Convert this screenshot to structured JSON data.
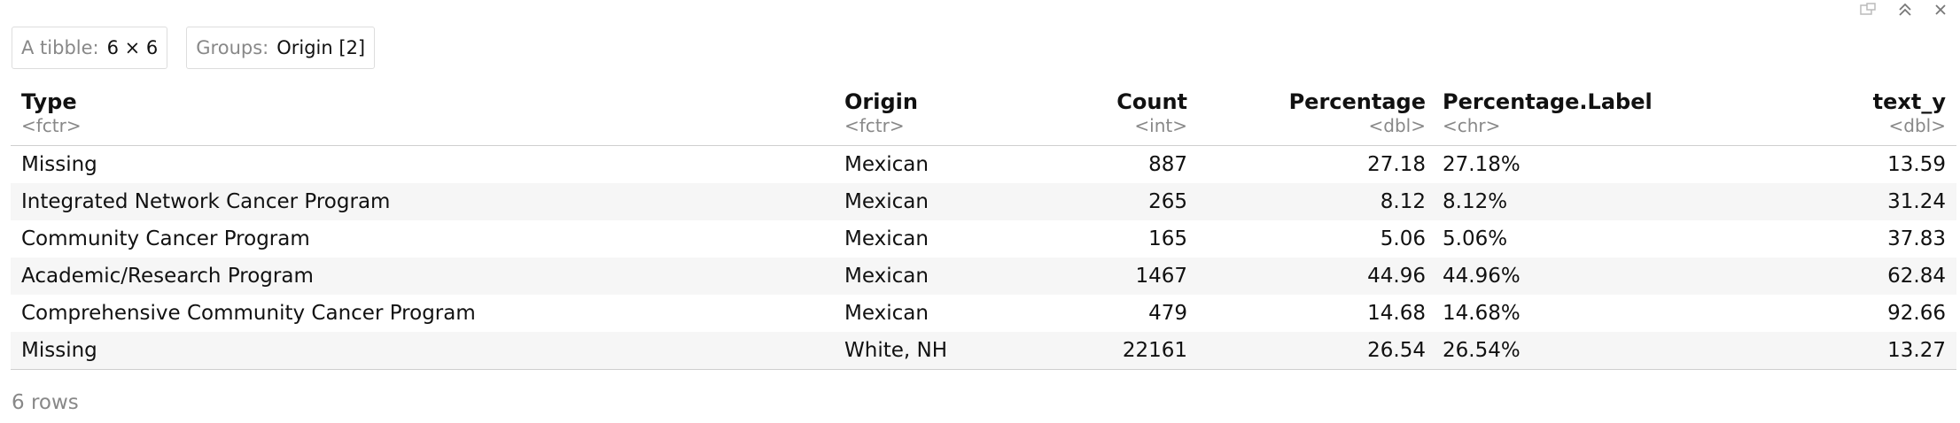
{
  "badges": {
    "tibble": {
      "key": "A tibble:",
      "value": "6 × 6"
    },
    "groups": {
      "key": "Groups:",
      "value": "Origin [2]"
    }
  },
  "columns": [
    {
      "name": "Type",
      "type": "<fctr>"
    },
    {
      "name": "Origin",
      "type": "<fctr>"
    },
    {
      "name": "Count",
      "type": "<int>"
    },
    {
      "name": "Percentage",
      "type": "<dbl>"
    },
    {
      "name": "Percentage.Label",
      "type": "<chr>"
    },
    {
      "name": "text_y",
      "type": "<dbl>"
    }
  ],
  "rows": [
    [
      "Missing",
      "Mexican",
      "887",
      "27.18",
      "27.18%",
      "13.59"
    ],
    [
      "Integrated Network Cancer Program",
      "Mexican",
      "265",
      "8.12",
      "8.12%",
      "31.24"
    ],
    [
      "Community Cancer Program",
      "Mexican",
      "165",
      "5.06",
      "5.06%",
      "37.83"
    ],
    [
      "Academic/Research Program",
      "Mexican",
      "1467",
      "44.96",
      "44.96%",
      "62.84"
    ],
    [
      "Comprehensive Community Cancer Program",
      "Mexican",
      "479",
      "14.68",
      "14.68%",
      "92.66"
    ],
    [
      "Missing",
      "White, NH",
      "22161",
      "26.54",
      "26.54%",
      "13.27"
    ]
  ],
  "footer": {
    "rows_label": "6 rows"
  },
  "icons": {
    "popout": "popout-icon",
    "collapse": "collapse-up-icon",
    "close": "close-icon"
  }
}
